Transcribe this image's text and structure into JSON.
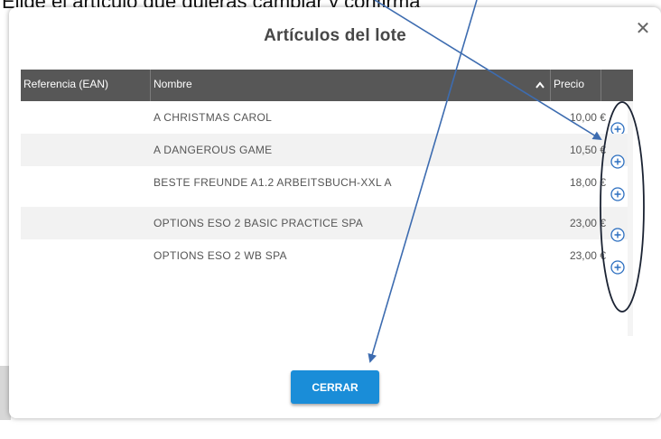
{
  "caption": "Elige el artículo que quieras cambiar y confirma",
  "modal": {
    "title": "Artículos del lote",
    "close_glyph": "✕"
  },
  "table": {
    "headers": {
      "referencia": "Referencia (EAN)",
      "nombre": "Nombre",
      "precio": "Precio"
    },
    "rows": [
      {
        "referencia": "",
        "nombre": "A CHRISTMAS CAROL",
        "precio": "10,00 €"
      },
      {
        "referencia": "",
        "nombre": "A DANGEROUS GAME",
        "precio": "10,50 €"
      },
      {
        "referencia": "",
        "nombre": "BESTE FREUNDE A1.2 ARBEITSBUCH-XXL A",
        "precio": "18,00 €"
      },
      {
        "referencia": "",
        "nombre": "OPTIONS ESO 2 BASIC PRACTICE SPA",
        "precio": "23,00 €"
      },
      {
        "referencia": "",
        "nombre": "OPTIONS ESO 2 WB SPA",
        "precio": "23,00 €"
      }
    ]
  },
  "footer": {
    "close_button": "CERRAR"
  },
  "colors": {
    "header_bg": "#575757",
    "primary_button": "#1a8dd8",
    "annotation": "#3d6cb0"
  }
}
